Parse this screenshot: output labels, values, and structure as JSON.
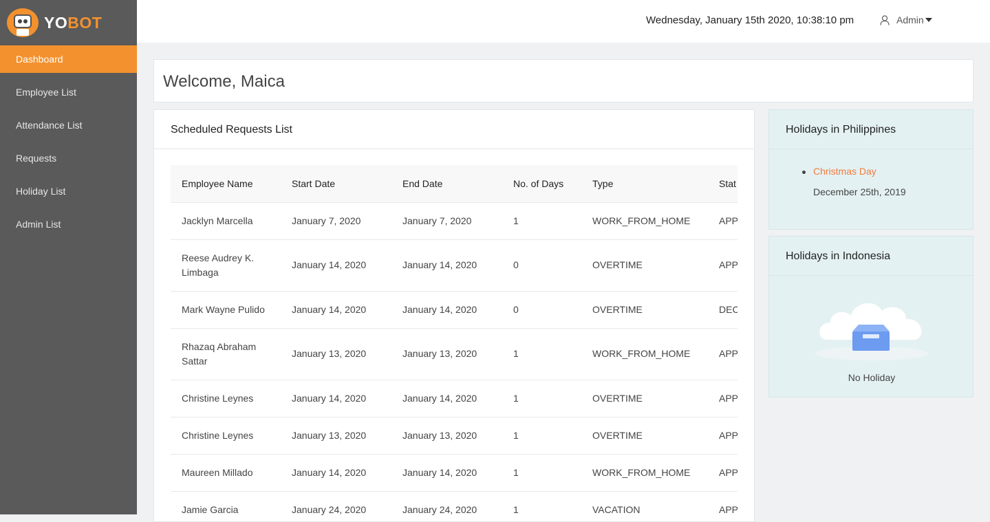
{
  "brand": {
    "part1": "YO",
    "part2": "BOT"
  },
  "sidebar": {
    "items": [
      {
        "label": "Dashboard",
        "active": true
      },
      {
        "label": "Employee List"
      },
      {
        "label": "Attendance List"
      },
      {
        "label": "Requests"
      },
      {
        "label": "Holiday List"
      },
      {
        "label": "Admin List"
      }
    ]
  },
  "header": {
    "datetime": "Wednesday, January 15th 2020, 10:38:10 pm",
    "user_label": "Admin",
    "user_icon": "user-icon"
  },
  "welcome": {
    "title": "Welcome, Maica"
  },
  "requests": {
    "title": "Scheduled Requests List",
    "columns": [
      "Employee Name",
      "Start Date",
      "End Date",
      "No. of Days",
      "Type",
      "Stat"
    ],
    "rows": [
      {
        "name": "Jacklyn Marcella",
        "start": "January 7, 2020",
        "end": "January 7, 2020",
        "days": "1",
        "type": "WORK_FROM_HOME",
        "status": "APP"
      },
      {
        "name": "Reese Audrey K. Limbaga",
        "start": "January 14, 2020",
        "end": "January 14, 2020",
        "days": "0",
        "type": "OVERTIME",
        "status": "APP"
      },
      {
        "name": "Mark Wayne Pulido",
        "start": "January 14, 2020",
        "end": "January 14, 2020",
        "days": "0",
        "type": "OVERTIME",
        "status": "DEC"
      },
      {
        "name": "Rhazaq Abraham Sattar",
        "start": "January 13, 2020",
        "end": "January 13, 2020",
        "days": "1",
        "type": "WORK_FROM_HOME",
        "status": "APP"
      },
      {
        "name": "Christine Leynes",
        "start": "January 14, 2020",
        "end": "January 14, 2020",
        "days": "1",
        "type": "OVERTIME",
        "status": "APP"
      },
      {
        "name": "Christine Leynes",
        "start": "January 13, 2020",
        "end": "January 13, 2020",
        "days": "1",
        "type": "OVERTIME",
        "status": "APP"
      },
      {
        "name": "Maureen Millado",
        "start": "January 14, 2020",
        "end": "January 14, 2020",
        "days": "1",
        "type": "WORK_FROM_HOME",
        "status": "APP"
      },
      {
        "name": "Jamie Garcia",
        "start": "January 24, 2020",
        "end": "January 24, 2020",
        "days": "1",
        "type": "VACATION",
        "status": "APP"
      }
    ]
  },
  "holidays_ph": {
    "title": "Holidays in Philippines",
    "items": [
      {
        "name": "Christmas Day",
        "date": "December 25th, 2019"
      }
    ]
  },
  "holidays_id": {
    "title": "Holidays in Indonesia",
    "empty_label": "No Holiday",
    "empty_icon": "empty-box-icon"
  },
  "colors": {
    "accent": "#f3912f",
    "sidebar_bg": "#5a5a5a",
    "panel_bg": "#e4f1f3",
    "holiday_link": "#f07b3d"
  }
}
